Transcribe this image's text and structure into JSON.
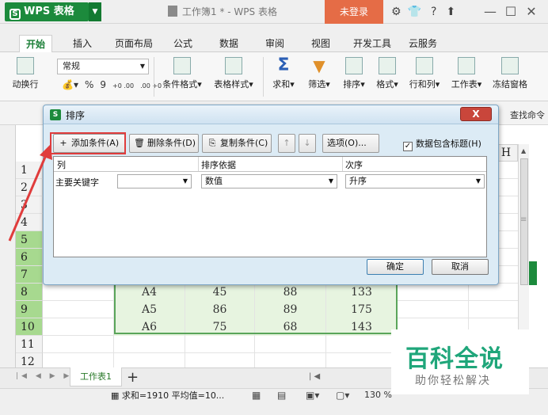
{
  "titlebar": {
    "app_name": "WPS 表格",
    "app_logo_letter": "S",
    "doc_title": "工作簿1 * - WPS 表格",
    "login_label": "未登录",
    "help_label": "?",
    "icons": [
      "settings-icon",
      "shirt-icon",
      "help-icon",
      "upload-icon",
      "minimize-icon",
      "maximize-icon",
      "close-icon"
    ]
  },
  "menu": {
    "tabs": [
      "开始",
      "插入",
      "页面布局",
      "公式",
      "数据",
      "审阅",
      "视图",
      "开发工具",
      "云服务"
    ],
    "active": "开始"
  },
  "ribbon": {
    "wrap_label": "动换行",
    "font_value": "常规",
    "percent": "%",
    "comma": "9",
    "inc_decimal": "+0 .00",
    "dec_decimal": ".00 +0",
    "conditional_format": "条件格式",
    "table_style": "表格样式",
    "sum": "求和",
    "filter": "筛选",
    "sort": "排序",
    "format": "格式",
    "rows_cols": "行和列",
    "worksheet": "工作表",
    "freeze": "冻结窗格",
    "find_command": "查找命令"
  },
  "sheet": {
    "column_h": "H",
    "rows": [
      {
        "num": "1",
        "cells": []
      },
      {
        "num": "2",
        "cells": []
      },
      {
        "num": "3",
        "cells": []
      },
      {
        "num": "4",
        "cells": []
      },
      {
        "num": "5",
        "cells": []
      },
      {
        "num": "6",
        "cells": []
      },
      {
        "num": "7",
        "cells": []
      },
      {
        "num": "8",
        "cells": [
          "A4",
          "45",
          "88",
          "133"
        ]
      },
      {
        "num": "9",
        "cells": [
          "A5",
          "86",
          "89",
          "175"
        ]
      },
      {
        "num": "10",
        "cells": [
          "A6",
          "75",
          "68",
          "143"
        ]
      },
      {
        "num": "11",
        "cells": []
      },
      {
        "num": "12",
        "cells": []
      }
    ],
    "tab_name": "工作表1",
    "add_sheet": "+"
  },
  "status": {
    "summary": "求和=1910 平均值=10...",
    "zoom": "130 %"
  },
  "dialog": {
    "title": "排序",
    "close_label": "X",
    "add_condition": "添加条件(A)",
    "delete_condition": "删除条件(D)",
    "copy_condition": "复制条件(C)",
    "up": "↑",
    "down": "↓",
    "options": "选项(O)...",
    "header_checkbox": "数据包含标题(H)",
    "header_checked": true,
    "columns": {
      "col": "列",
      "sort_by": "排序依据",
      "order": "次序"
    },
    "row": {
      "label": "主要关键字",
      "key_value": "",
      "sort_by_value": "数值",
      "order_value": "升序"
    },
    "ok": "确定",
    "cancel": "取消"
  },
  "watermark": {
    "title": "百科全说",
    "subtitle": "助你轻松解决"
  },
  "colors": {
    "brand": "#1c8a3c",
    "login": "#e56c46",
    "highlight": "#e03c3c",
    "selection": "#5aa55a",
    "watermark": "#1fa67a"
  }
}
